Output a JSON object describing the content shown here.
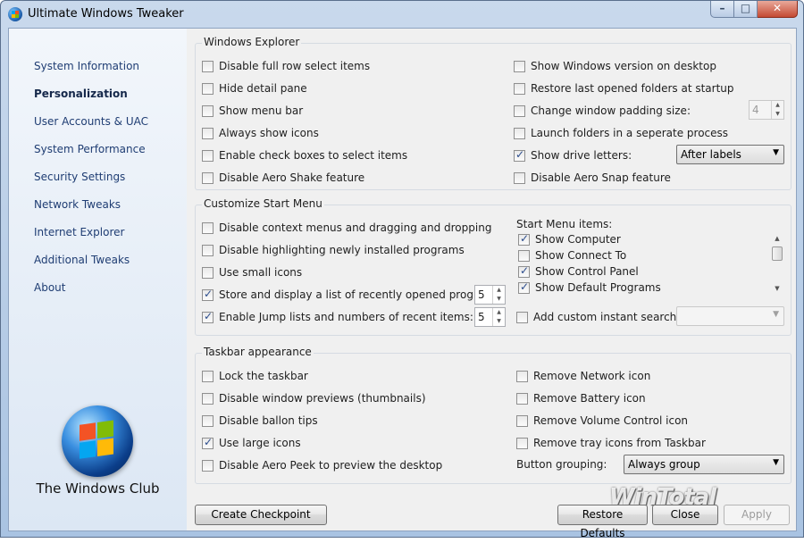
{
  "window": {
    "title": "Ultimate Windows Tweaker",
    "min_glyph": "–",
    "max_glyph": "□",
    "close_glyph": "✕"
  },
  "sidebar": {
    "items": [
      {
        "label": "System Information",
        "active": false
      },
      {
        "label": "Personalization",
        "active": true
      },
      {
        "label": "User Accounts & UAC",
        "active": false
      },
      {
        "label": "System Performance",
        "active": false
      },
      {
        "label": "Security Settings",
        "active": false
      },
      {
        "label": "Network Tweaks",
        "active": false
      },
      {
        "label": "Internet Explorer",
        "active": false
      },
      {
        "label": "Additional Tweaks",
        "active": false
      },
      {
        "label": "About",
        "active": false
      }
    ],
    "logo_text": "The Windows Club"
  },
  "explorer": {
    "title": "Windows Explorer",
    "left": [
      {
        "label": "Disable full row select items",
        "checked": false
      },
      {
        "label": "Hide detail pane",
        "checked": false
      },
      {
        "label": "Show menu bar",
        "checked": false
      },
      {
        "label": "Always show icons",
        "checked": false
      },
      {
        "label": "Enable check boxes to select items",
        "checked": false
      },
      {
        "label": "Disable Aero Shake feature",
        "checked": false
      }
    ],
    "right": [
      {
        "label": "Show Windows version on desktop",
        "checked": false
      },
      {
        "label": "Restore last opened folders at startup",
        "checked": false
      },
      {
        "label": "Change window padding size:",
        "checked": false
      },
      {
        "label": "Launch folders in a seperate process",
        "checked": false
      },
      {
        "label": "Show drive letters:",
        "checked": true
      },
      {
        "label": "Disable Aero Snap feature",
        "checked": false
      }
    ],
    "padding_value": "4",
    "drive_letters_option": "After labels"
  },
  "start_menu": {
    "title": "Customize Start Menu",
    "left": [
      {
        "label": "Disable context menus and dragging and dropping",
        "checked": false
      },
      {
        "label": "Disable highlighting newly installed programs",
        "checked": false
      },
      {
        "label": "Use small icons",
        "checked": false
      },
      {
        "label": "Store and display a list of recently opened programs:",
        "checked": true
      },
      {
        "label": "Enable Jump lists and numbers of recent items:",
        "checked": true
      }
    ],
    "recent_programs_value": "5",
    "jump_list_value": "5",
    "items_label": "Start Menu items:",
    "items": [
      {
        "label": "Show Computer",
        "checked": true
      },
      {
        "label": "Show Connect To",
        "checked": false
      },
      {
        "label": "Show Control Panel",
        "checked": true
      },
      {
        "label": "Show Default Programs",
        "checked": true
      }
    ],
    "custom_search": {
      "label": "Add custom instant search:",
      "checked": false,
      "value": ""
    }
  },
  "taskbar": {
    "title": "Taskbar appearance",
    "left": [
      {
        "label": "Lock the taskbar",
        "checked": false
      },
      {
        "label": "Disable window previews (thumbnails)",
        "checked": false
      },
      {
        "label": "Disable ballon tips",
        "checked": false
      },
      {
        "label": "Use large icons",
        "checked": true
      },
      {
        "label": "Disable Aero Peek to preview the desktop",
        "checked": false
      }
    ],
    "right": [
      {
        "label": "Remove Network icon",
        "checked": false
      },
      {
        "label": "Remove Battery icon",
        "checked": false
      },
      {
        "label": "Remove Volume Control icon",
        "checked": false
      },
      {
        "label": "Remove tray icons from Taskbar",
        "checked": false
      }
    ],
    "grouping_label": "Button grouping:",
    "grouping_value": "Always group"
  },
  "buttons": {
    "checkpoint": "Create Checkpoint",
    "restore": "Restore Defaults",
    "close": "Close",
    "apply": "Apply"
  },
  "watermark": "WinTotal"
}
